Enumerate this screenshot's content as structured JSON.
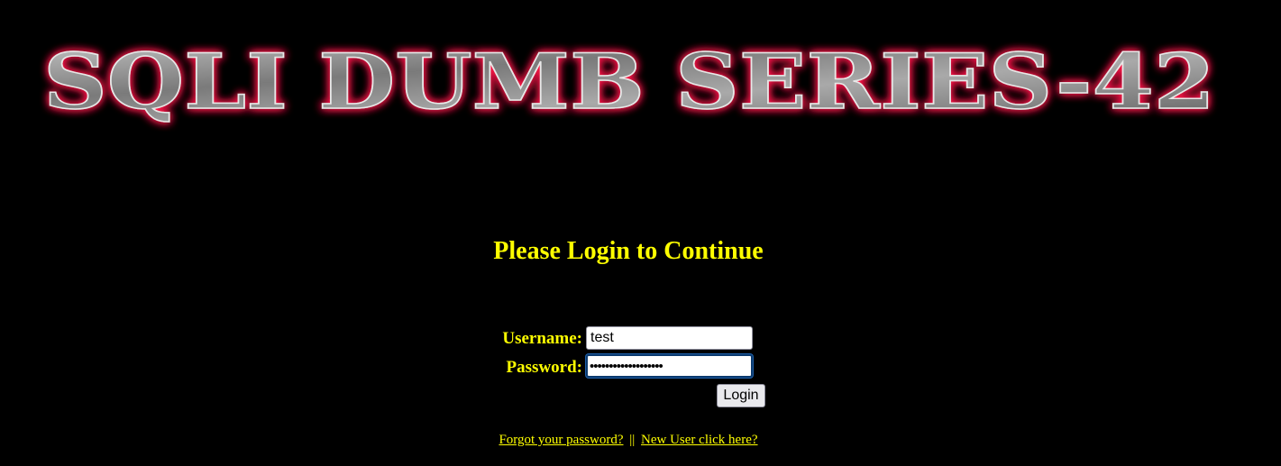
{
  "banner": {
    "text": "SQLI DUMB SERIES-42",
    "glow_color": "#ff1a4a",
    "fill_color": "#8a8a8a"
  },
  "login": {
    "heading": "Please Login to Continue",
    "username_label": "Username:",
    "username_value": "test",
    "password_label": "Password:",
    "password_value": "•••••••••••••••••••",
    "button_label": "Login"
  },
  "links": {
    "forgot": "Forgot your password?",
    "separator": "||",
    "new_user": "New User click here?"
  },
  "colors": {
    "background": "#000000",
    "text_accent": "#ffff00"
  }
}
